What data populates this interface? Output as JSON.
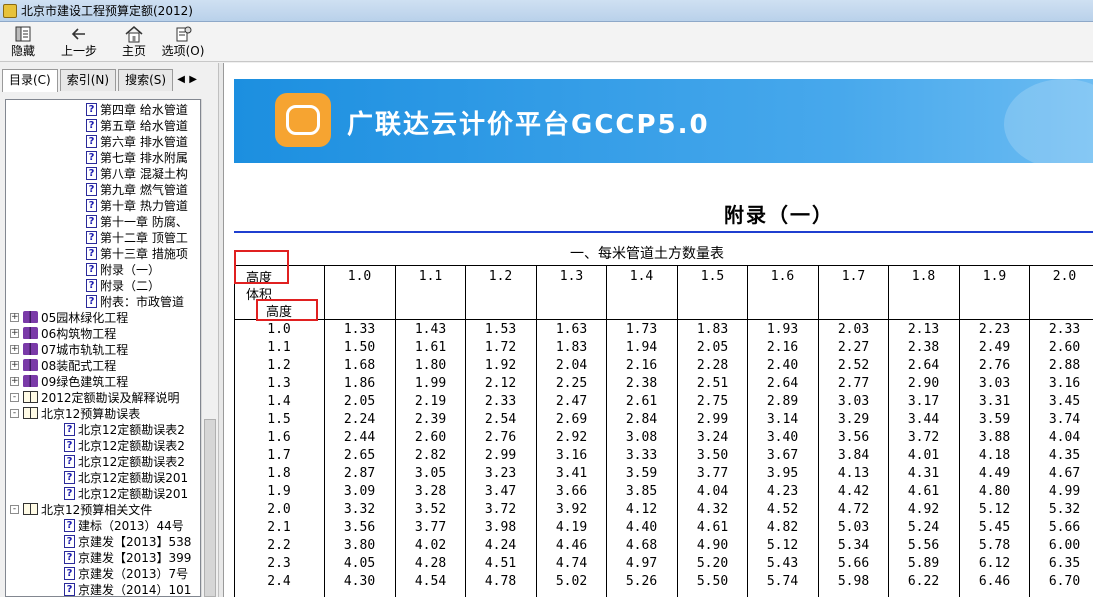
{
  "window": {
    "title": "北京市建设工程预算定额(2012)"
  },
  "toolbar": {
    "buttons": [
      {
        "label": "隐藏",
        "icon": "hide-pane-icon"
      },
      {
        "label": "上一步",
        "icon": "back-arrow-icon"
      },
      {
        "label": "主页",
        "icon": "home-icon"
      },
      {
        "label": "选项(O)",
        "icon": "options-icon"
      }
    ]
  },
  "tabs": [
    {
      "label": "目录(C)",
      "active": true
    },
    {
      "label": "索引(N)",
      "active": false
    },
    {
      "label": "搜索(S)",
      "active": false
    }
  ],
  "tree": {
    "items": [
      {
        "label": "第四章  给水管道",
        "type": "page",
        "level": 4
      },
      {
        "label": "第五章  给水管道",
        "type": "page",
        "level": 4
      },
      {
        "label": "第六章  排水管道",
        "type": "page",
        "level": 4
      },
      {
        "label": "第七章  排水附属",
        "type": "page",
        "level": 4
      },
      {
        "label": "第八章  混凝土构",
        "type": "page",
        "level": 4
      },
      {
        "label": "第九章  燃气管道",
        "type": "page",
        "level": 4
      },
      {
        "label": "第十章  热力管道",
        "type": "page",
        "level": 4
      },
      {
        "label": "第十一章  防腐、",
        "type": "page",
        "level": 4
      },
      {
        "label": "第十二章  顶管工",
        "type": "page",
        "level": 4
      },
      {
        "label": "第十三章  措施项",
        "type": "page",
        "level": 4
      },
      {
        "label": "附录（一）",
        "type": "page",
        "level": 4
      },
      {
        "label": "附录（二）",
        "type": "page",
        "level": 4
      },
      {
        "label": "附表：市政管道",
        "type": "page",
        "level": 4
      },
      {
        "label": "05园林绿化工程",
        "type": "book",
        "level": 2,
        "toggle": "+"
      },
      {
        "label": "06构筑物工程",
        "type": "book",
        "level": 2,
        "toggle": "+"
      },
      {
        "label": "07城市轨轨工程",
        "type": "book",
        "level": 2,
        "toggle": "+"
      },
      {
        "label": "08装配式工程",
        "type": "book",
        "level": 2,
        "toggle": "+"
      },
      {
        "label": "09绿色建筑工程",
        "type": "book",
        "level": 2,
        "toggle": "+"
      },
      {
        "label": "2012定额勘误及解释说明",
        "type": "bookopen",
        "level": 1,
        "toggle": "-"
      },
      {
        "label": "北京12预算勘误表",
        "type": "bookopen",
        "level": 2,
        "toggle": "-"
      },
      {
        "label": "北京12定额勘误表2",
        "type": "page",
        "level": 3
      },
      {
        "label": "北京12定额勘误表2",
        "type": "page",
        "level": 3
      },
      {
        "label": "北京12定额勘误表2",
        "type": "page",
        "level": 3
      },
      {
        "label": "北京12定额勘误201",
        "type": "page",
        "level": 3
      },
      {
        "label": "北京12定额勘误201",
        "type": "page",
        "level": 3
      },
      {
        "label": "北京12预算相关文件",
        "type": "bookopen",
        "level": 2,
        "toggle": "-"
      },
      {
        "label": "建标（2013）44号",
        "type": "page",
        "level": 3
      },
      {
        "label": "京建发【2013】538",
        "type": "page",
        "level": 3
      },
      {
        "label": "京建发【2013】399",
        "type": "page",
        "level": 3
      },
      {
        "label": "京建发（2013）7号",
        "type": "page",
        "level": 3
      },
      {
        "label": "京建发（2014）101",
        "type": "page",
        "level": 3
      }
    ]
  },
  "content": {
    "banner_title": "广联达云计价平台GCCP5.0",
    "page_title": "附录（一）",
    "table_title": "一、每米管道土方数量表",
    "corner": {
      "top": "高度",
      "middle": "体积",
      "bottom": "高度"
    },
    "columns": [
      "1.0",
      "1.1",
      "1.2",
      "1.3",
      "1.4",
      "1.5",
      "1.6",
      "1.7",
      "1.8",
      "1.9",
      "2.0"
    ],
    "rows": [
      {
        "h": "1.0",
        "v": [
          "1.33",
          "1.43",
          "1.53",
          "1.63",
          "1.73",
          "1.83",
          "1.93",
          "2.03",
          "2.13",
          "2.23",
          "2.33"
        ]
      },
      {
        "h": "1.1",
        "v": [
          "1.50",
          "1.61",
          "1.72",
          "1.83",
          "1.94",
          "2.05",
          "2.16",
          "2.27",
          "2.38",
          "2.49",
          "2.60"
        ]
      },
      {
        "h": "1.2",
        "v": [
          "1.68",
          "1.80",
          "1.92",
          "2.04",
          "2.16",
          "2.28",
          "2.40",
          "2.52",
          "2.64",
          "2.76",
          "2.88"
        ]
      },
      {
        "h": "1.3",
        "v": [
          "1.86",
          "1.99",
          "2.12",
          "2.25",
          "2.38",
          "2.51",
          "2.64",
          "2.77",
          "2.90",
          "3.03",
          "3.16"
        ]
      },
      {
        "h": "1.4",
        "v": [
          "2.05",
          "2.19",
          "2.33",
          "2.47",
          "2.61",
          "2.75",
          "2.89",
          "3.03",
          "3.17",
          "3.31",
          "3.45"
        ]
      },
      {
        "h": "1.5",
        "v": [
          "2.24",
          "2.39",
          "2.54",
          "2.69",
          "2.84",
          "2.99",
          "3.14",
          "3.29",
          "3.44",
          "3.59",
          "3.74"
        ]
      },
      {
        "h": "1.6",
        "v": [
          "2.44",
          "2.60",
          "2.76",
          "2.92",
          "3.08",
          "3.24",
          "3.40",
          "3.56",
          "3.72",
          "3.88",
          "4.04"
        ]
      },
      {
        "h": "1.7",
        "v": [
          "2.65",
          "2.82",
          "2.99",
          "3.16",
          "3.33",
          "3.50",
          "3.67",
          "3.84",
          "4.01",
          "4.18",
          "4.35"
        ]
      },
      {
        "h": "1.8",
        "v": [
          "2.87",
          "3.05",
          "3.23",
          "3.41",
          "3.59",
          "3.77",
          "3.95",
          "4.13",
          "4.31",
          "4.49",
          "4.67"
        ]
      },
      {
        "h": "1.9",
        "v": [
          "3.09",
          "3.28",
          "3.47",
          "3.66",
          "3.85",
          "4.04",
          "4.23",
          "4.42",
          "4.61",
          "4.80",
          "4.99"
        ]
      },
      {
        "h": "2.0",
        "v": [
          "3.32",
          "3.52",
          "3.72",
          "3.92",
          "4.12",
          "4.32",
          "4.52",
          "4.72",
          "4.92",
          "5.12",
          "5.32"
        ]
      },
      {
        "h": "2.1",
        "v": [
          "3.56",
          "3.77",
          "3.98",
          "4.19",
          "4.40",
          "4.61",
          "4.82",
          "5.03",
          "5.24",
          "5.45",
          "5.66"
        ]
      },
      {
        "h": "2.2",
        "v": [
          "3.80",
          "4.02",
          "4.24",
          "4.46",
          "4.68",
          "4.90",
          "5.12",
          "5.34",
          "5.56",
          "5.78",
          "6.00"
        ]
      },
      {
        "h": "2.3",
        "v": [
          "4.05",
          "4.28",
          "4.51",
          "4.74",
          "4.97",
          "5.20",
          "5.43",
          "5.66",
          "5.89",
          "6.12",
          "6.35"
        ]
      },
      {
        "h": "2.4",
        "v": [
          "4.30",
          "4.54",
          "4.78",
          "5.02",
          "5.26",
          "5.50",
          "5.74",
          "5.98",
          "6.22",
          "6.46",
          "6.70"
        ]
      }
    ]
  }
}
